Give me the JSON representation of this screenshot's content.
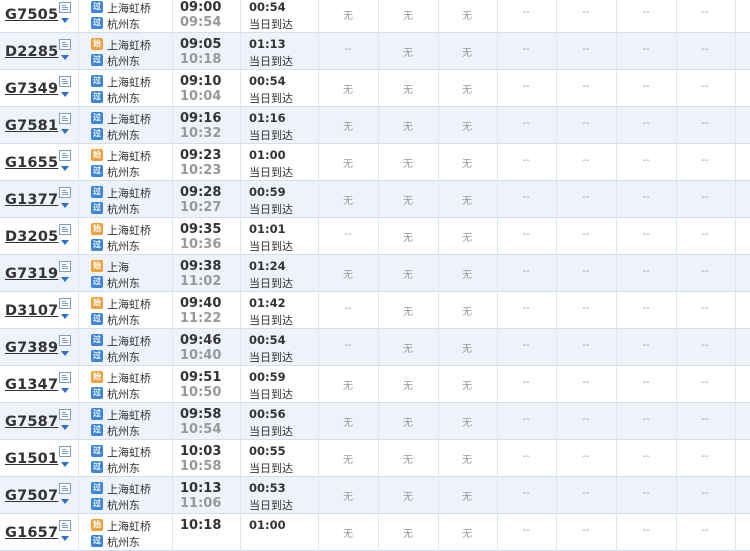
{
  "labels": {
    "pass_badge": "过",
    "start_badge": "始"
  },
  "colors": {
    "row_alt_background": "#eef3fb",
    "pass_badge": "#3d86d6",
    "start_badge": "#f0a03c",
    "arrival_time": "#999999",
    "seat_text": "#999999"
  },
  "icons": {
    "train_info": "info-card-icon",
    "expand": "chevron-down-icon"
  },
  "rows": [
    {
      "train": "G7505",
      "from_station": "上海虹桥",
      "to_station": "杭州东",
      "from_type": "pass",
      "to_type": "pass",
      "depart": "09:00",
      "arrive": "09:54",
      "duration": "00:54",
      "arrive_note": "当日到达",
      "seats": [
        "无",
        "无",
        "无",
        "--",
        "--",
        "--",
        "--"
      ]
    },
    {
      "train": "D2285",
      "from_station": "上海虹桥",
      "to_station": "杭州东",
      "from_type": "start",
      "to_type": "pass",
      "depart": "09:05",
      "arrive": "10:18",
      "duration": "01:13",
      "arrive_note": "当日到达",
      "seats": [
        "--",
        "无",
        "无",
        "--",
        "--",
        "--",
        "--"
      ]
    },
    {
      "train": "G7349",
      "from_station": "上海虹桥",
      "to_station": "杭州东",
      "from_type": "pass",
      "to_type": "pass",
      "depart": "09:10",
      "arrive": "10:04",
      "duration": "00:54",
      "arrive_note": "当日到达",
      "seats": [
        "无",
        "无",
        "无",
        "--",
        "--",
        "--",
        "--"
      ]
    },
    {
      "train": "G7581",
      "from_station": "上海虹桥",
      "to_station": "杭州东",
      "from_type": "pass",
      "to_type": "pass",
      "depart": "09:16",
      "arrive": "10:32",
      "duration": "01:16",
      "arrive_note": "当日到达",
      "seats": [
        "无",
        "无",
        "无",
        "--",
        "--",
        "--",
        "--"
      ]
    },
    {
      "train": "G1655",
      "from_station": "上海虹桥",
      "to_station": "杭州东",
      "from_type": "start",
      "to_type": "pass",
      "depart": "09:23",
      "arrive": "10:23",
      "duration": "01:00",
      "arrive_note": "当日到达",
      "seats": [
        "无",
        "无",
        "无",
        "--",
        "--",
        "--",
        "--"
      ]
    },
    {
      "train": "G1377",
      "from_station": "上海虹桥",
      "to_station": "杭州东",
      "from_type": "pass",
      "to_type": "pass",
      "depart": "09:28",
      "arrive": "10:27",
      "duration": "00:59",
      "arrive_note": "当日到达",
      "seats": [
        "无",
        "无",
        "无",
        "--",
        "--",
        "--",
        "--"
      ]
    },
    {
      "train": "D3205",
      "from_station": "上海虹桥",
      "to_station": "杭州东",
      "from_type": "start",
      "to_type": "pass",
      "depart": "09:35",
      "arrive": "10:36",
      "duration": "01:01",
      "arrive_note": "当日到达",
      "seats": [
        "--",
        "无",
        "无",
        "--",
        "--",
        "--",
        "--"
      ]
    },
    {
      "train": "G7319",
      "from_station": "上海",
      "to_station": "杭州东",
      "from_type": "start",
      "to_type": "pass",
      "depart": "09:38",
      "arrive": "11:02",
      "duration": "01:24",
      "arrive_note": "当日到达",
      "seats": [
        "无",
        "无",
        "无",
        "--",
        "--",
        "--",
        "--"
      ]
    },
    {
      "train": "D3107",
      "from_station": "上海虹桥",
      "to_station": "杭州东",
      "from_type": "start",
      "to_type": "pass",
      "depart": "09:40",
      "arrive": "11:22",
      "duration": "01:42",
      "arrive_note": "当日到达",
      "seats": [
        "--",
        "无",
        "无",
        "--",
        "--",
        "--",
        "--"
      ]
    },
    {
      "train": "G7389",
      "from_station": "上海虹桥",
      "to_station": "杭州东",
      "from_type": "pass",
      "to_type": "pass",
      "depart": "09:46",
      "arrive": "10:40",
      "duration": "00:54",
      "arrive_note": "当日到达",
      "seats": [
        "--",
        "无",
        "无",
        "--",
        "--",
        "--",
        "--"
      ]
    },
    {
      "train": "G1347",
      "from_station": "上海虹桥",
      "to_station": "杭州东",
      "from_type": "start",
      "to_type": "pass",
      "depart": "09:51",
      "arrive": "10:50",
      "duration": "00:59",
      "arrive_note": "当日到达",
      "seats": [
        "无",
        "无",
        "无",
        "--",
        "--",
        "--",
        "--"
      ]
    },
    {
      "train": "G7587",
      "from_station": "上海虹桥",
      "to_station": "杭州东",
      "from_type": "pass",
      "to_type": "pass",
      "depart": "09:58",
      "arrive": "10:54",
      "duration": "00:56",
      "arrive_note": "当日到达",
      "seats": [
        "无",
        "无",
        "无",
        "--",
        "--",
        "--",
        "--"
      ]
    },
    {
      "train": "G1501",
      "from_station": "上海虹桥",
      "to_station": "杭州东",
      "from_type": "pass",
      "to_type": "pass",
      "depart": "10:03",
      "arrive": "10:58",
      "duration": "00:55",
      "arrive_note": "当日到达",
      "seats": [
        "无",
        "无",
        "无",
        "--",
        "--",
        "--",
        "--"
      ]
    },
    {
      "train": "G7507",
      "from_station": "上海虹桥",
      "to_station": "杭州东",
      "from_type": "pass",
      "to_type": "pass",
      "depart": "10:13",
      "arrive": "11:06",
      "duration": "00:53",
      "arrive_note": "当日到达",
      "seats": [
        "无",
        "无",
        "无",
        "--",
        "--",
        "--",
        "--"
      ]
    },
    {
      "train": "G1657",
      "from_station": "上海虹桥",
      "to_station": "杭州东",
      "from_type": "start",
      "to_type": "pass",
      "depart": "10:18",
      "arrive": "",
      "duration": "01:00",
      "arrive_note": "",
      "seats": [
        "无",
        "无",
        "无",
        "--",
        "--",
        "--",
        "--"
      ]
    }
  ]
}
